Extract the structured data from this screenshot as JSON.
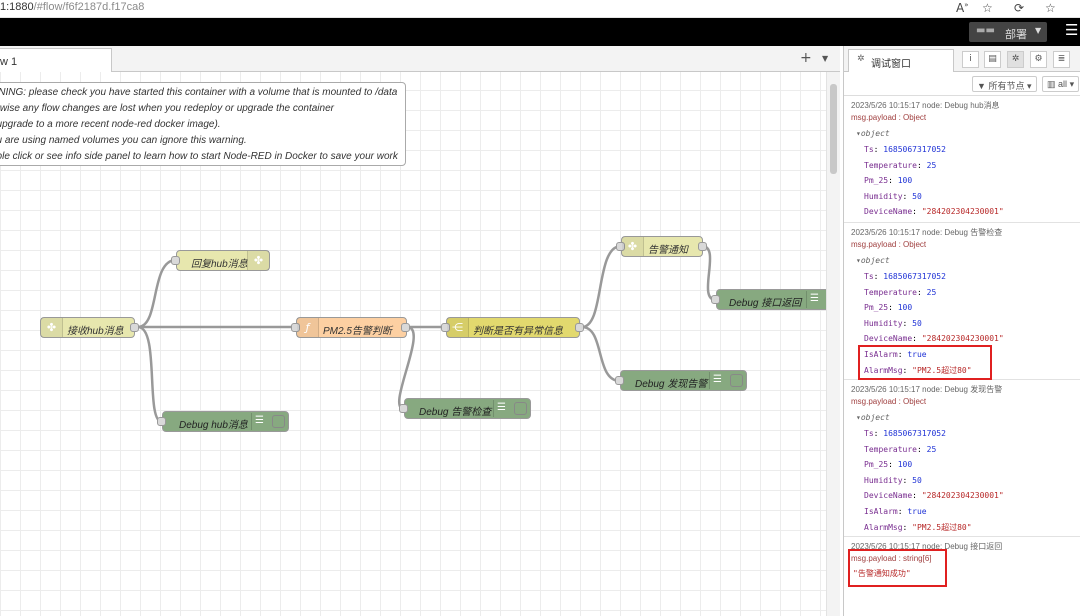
{
  "browser": {
    "url_prefix": "1:1880",
    "url_path": "/#flow/f6f2187d.f17ca8"
  },
  "header": {
    "deploy_label": "部署"
  },
  "workspace": {
    "tab_label": "w 1",
    "warning_lines": [
      "RNING: please check you have started this container with a volume that is mounted to /data",
      "erwise any flow changes are lost when you redeploy or upgrade the container",
      ". upgrade to a more recent node-red docker image).",
      "ou are using named volumes you can ignore this warning.",
      "uble click or see info side panel to learn how to start Node-RED in Docker to save your work"
    ],
    "nodes": {
      "receive_hub": "接收hub消息",
      "reply_hub": "回复hub消息",
      "debug_hub": "Debug hub消息",
      "pm25_judge": "PM2.5告警判断",
      "debug_alarm_check": "Debug 告警检查",
      "switch_abnormal": "判断是否有异常信息",
      "alarm_notice": "告警通知",
      "debug_api_return": "Debug 接口返回",
      "debug_found_alarm": "Debug 发现告警"
    }
  },
  "sidebar": {
    "tab_label": "调试窗口",
    "filter_nodes": "所有节点",
    "filter_clear": "all",
    "messages": [
      {
        "meta": "2023/5/26 10:15:17   node: Debug hub消息",
        "topic": "msg.payload : Object",
        "obj": "object",
        "props": [
          {
            "k": "Ts",
            "v": "1685067317052",
            "t": "n"
          },
          {
            "k": "Temperature",
            "v": "25",
            "t": "n"
          },
          {
            "k": "Pm_25",
            "v": "100",
            "t": "n"
          },
          {
            "k": "Humidity",
            "v": "50",
            "t": "n"
          },
          {
            "k": "DeviceName",
            "v": "\"284202304230001\"",
            "t": "s"
          }
        ]
      },
      {
        "meta": "2023/5/26 10:15:17   node: Debug 告警检查",
        "topic": "msg.payload : Object",
        "obj": "object",
        "props": [
          {
            "k": "Ts",
            "v": "1685067317052",
            "t": "n"
          },
          {
            "k": "Temperature",
            "v": "25",
            "t": "n"
          },
          {
            "k": "Pm_25",
            "v": "100",
            "t": "n"
          },
          {
            "k": "Humidity",
            "v": "50",
            "t": "n"
          },
          {
            "k": "DeviceName",
            "v": "\"284202304230001\"",
            "t": "s"
          },
          {
            "k": "IsAlarm",
            "v": "true",
            "t": "b"
          },
          {
            "k": "AlarmMsg",
            "v": "\"PM2.5超过80\"",
            "t": "s"
          }
        ]
      },
      {
        "meta": "2023/5/26 10:15:17   node: Debug 发现告警",
        "topic": "msg.payload : Object",
        "obj": "object",
        "props": [
          {
            "k": "Ts",
            "v": "1685067317052",
            "t": "n"
          },
          {
            "k": "Temperature",
            "v": "25",
            "t": "n"
          },
          {
            "k": "Pm_25",
            "v": "100",
            "t": "n"
          },
          {
            "k": "Humidity",
            "v": "50",
            "t": "n"
          },
          {
            "k": "DeviceName",
            "v": "\"284202304230001\"",
            "t": "s"
          },
          {
            "k": "IsAlarm",
            "v": "true",
            "t": "b"
          },
          {
            "k": "AlarmMsg",
            "v": "\"PM2.5超过80\"",
            "t": "s"
          }
        ]
      },
      {
        "meta": "2023/5/26 10:15:17   node: Debug 接口返回",
        "topic": "msg.payload : string[6]",
        "value": "\"告警通知成功\""
      }
    ]
  }
}
